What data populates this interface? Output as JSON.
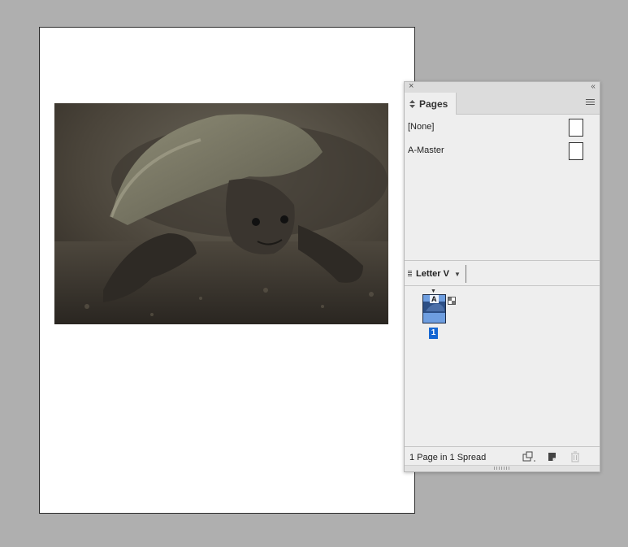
{
  "document": {
    "photo": {
      "subject": "turtle photograph"
    }
  },
  "panel": {
    "close_glyph": "×",
    "collapse_glyph": "‹‹",
    "tab_label": "Pages",
    "tab_updown_glyph": "◇",
    "masters": [
      {
        "label": "[None]"
      },
      {
        "label": "A-Master"
      }
    ],
    "size_label": "Letter V",
    "size_caret": "▼",
    "page": {
      "master_letter": "A",
      "number": "1"
    },
    "status_text": "1 Page in 1 Spread",
    "icons": [
      "close-icon",
      "collapse-icon",
      "panel-menu-icon",
      "edit-page-size-icon",
      "new-page-icon",
      "delete-page-icon"
    ],
    "colors": {
      "selection": "#1667d2",
      "panel_bg": "#eeeeee"
    }
  }
}
